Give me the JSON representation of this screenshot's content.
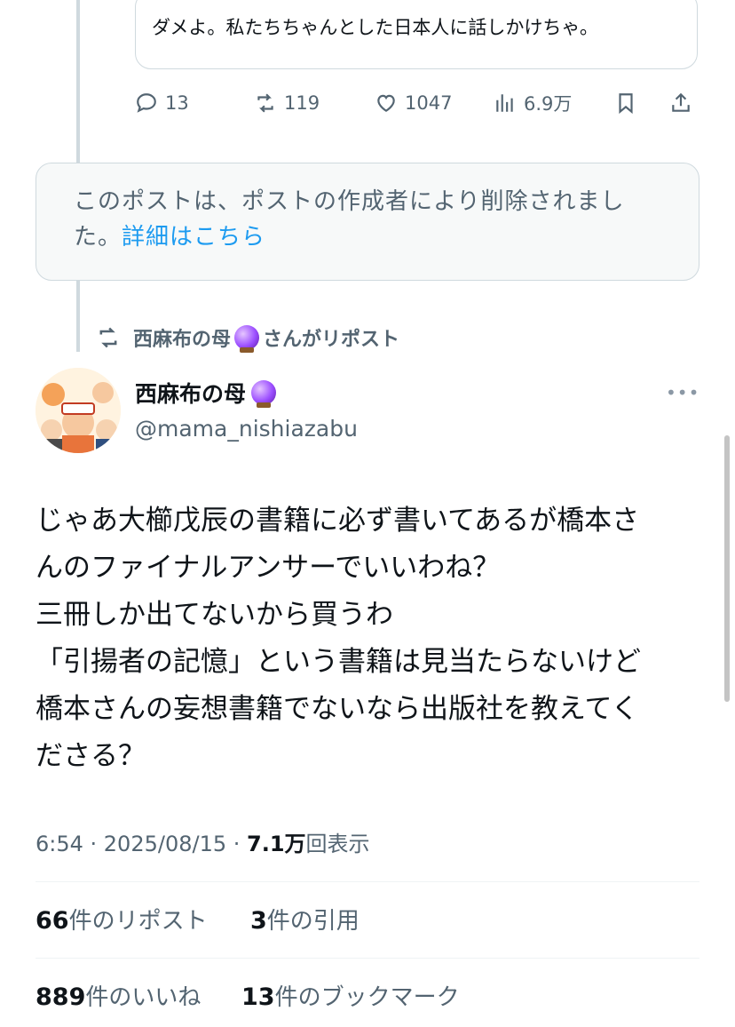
{
  "quoted_tweet": {
    "text": "ダメよ。私たちちゃんとした日本人に話しかけちゃ。"
  },
  "actions": {
    "replies": "13",
    "reposts": "119",
    "likes": "1047",
    "views": "6.9万"
  },
  "deleted_notice": {
    "text": "このポストは、ポストの作成者により削除されました。",
    "link": "詳細はこちら"
  },
  "repost_label": {
    "name": "西麻布の母",
    "suffix": "さんがリポスト"
  },
  "author": {
    "name": "西麻布の母",
    "handle": "@mama_nishiazabu",
    "more": "•••"
  },
  "post": {
    "lines": [
      "じゃあ大櫛戊辰の書籍に必ず書いてあるが橋本さ",
      "んのファイナルアンサーでいいわね？",
      "三冊しか出てないから買うわ",
      "「引揚者の記憶」という書籍は見当たらないけど",
      "橋本さんの妄想書籍でないなら出版社を教えてく",
      "ださる？"
    ],
    "time": "6:54 · 2025/08/15 · ",
    "views_count": "7.1万",
    "views_label": "回表示"
  },
  "stats": {
    "reposts_count": "66",
    "reposts_label": "件のリポスト",
    "quotes_count": "3",
    "quotes_label": "件の引用",
    "likes_count": "889",
    "likes_label": "件のいいね",
    "bookmarks_count": "13",
    "bookmarks_label": "件のブックマーク"
  }
}
